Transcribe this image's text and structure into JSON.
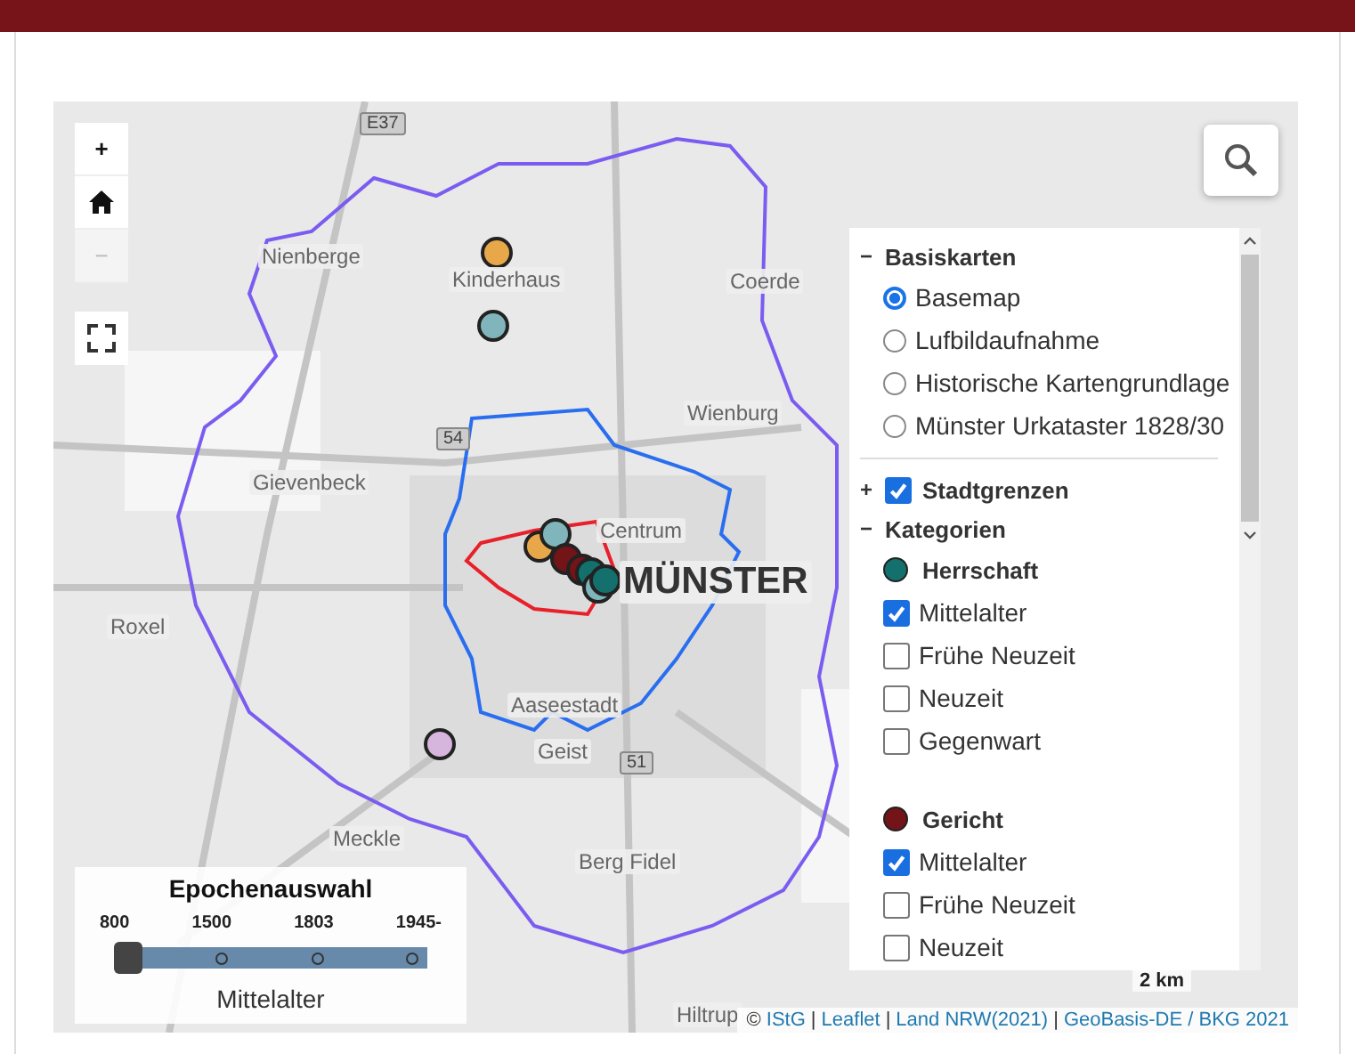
{
  "map": {
    "place_labels": [
      {
        "text": "Nienberge",
        "kind": "place"
      },
      {
        "text": "Kinderhaus",
        "kind": "place"
      },
      {
        "text": "Coerde",
        "kind": "place"
      },
      {
        "text": "Gievenbeck",
        "kind": "place"
      },
      {
        "text": "Wienburg",
        "kind": "place"
      },
      {
        "text": "Centrum",
        "kind": "place"
      },
      {
        "text": "MÜNSTER",
        "kind": "city"
      },
      {
        "text": "Roxel",
        "kind": "place"
      },
      {
        "text": "Aaseestadt",
        "kind": "place"
      },
      {
        "text": "Geist",
        "kind": "place"
      },
      {
        "text": "Meckle",
        "kind": "place"
      },
      {
        "text": "Berg Fidel",
        "kind": "place"
      },
      {
        "text": "Hiltrup",
        "kind": "place"
      },
      {
        "text": "E37",
        "kind": "road"
      },
      {
        "text": "54",
        "kind": "road"
      },
      {
        "text": "51",
        "kind": "road"
      }
    ]
  },
  "zoom_controls": [
    {
      "label": "+",
      "disabled": false
    },
    {
      "label": "−",
      "disabled": true
    }
  ],
  "layer_panel": {
    "basemaps": {
      "toggle": "−",
      "title": "Basiskarten",
      "options": [
        {
          "label": "Basemap",
          "selected": true
        },
        {
          "label": "Lufbildaufnahme",
          "selected": false
        },
        {
          "label": "Historische Kartengrundlage",
          "selected": false
        },
        {
          "label": "Münster Urkataster 1828/30",
          "selected": false
        }
      ]
    },
    "boundaries": {
      "toggle": "+",
      "label": "Stadtgrenzen",
      "checked": true
    },
    "categories": {
      "toggle": "−",
      "title": "Kategorien",
      "groups": [
        {
          "name": "Herrschaft",
          "color": "#13706c",
          "items": [
            {
              "label": "Mittelalter",
              "checked": true
            },
            {
              "label": "Frühe Neuzeit",
              "checked": false
            },
            {
              "label": "Neuzeit",
              "checked": false
            },
            {
              "label": "Gegenwart",
              "checked": false
            }
          ]
        },
        {
          "name": "Gericht",
          "color": "#731418",
          "items": [
            {
              "label": "Mittelalter",
              "checked": true
            },
            {
              "label": "Frühe Neuzeit",
              "checked": false
            },
            {
              "label": "Neuzeit",
              "checked": false
            }
          ]
        }
      ]
    }
  },
  "epoch_panel": {
    "title": "Epochenauswahl",
    "ticks": [
      "800",
      "1500",
      "1803",
      "1945-"
    ],
    "level": 0,
    "label": "Mittelalter"
  },
  "scale": "2 km",
  "attribution": {
    "prefix": "©",
    "separator": "|",
    "links": [
      "IStG",
      "Leaflet",
      "Land NRW(2021)",
      "GeoBasis-DE / BKG 2021"
    ]
  }
}
